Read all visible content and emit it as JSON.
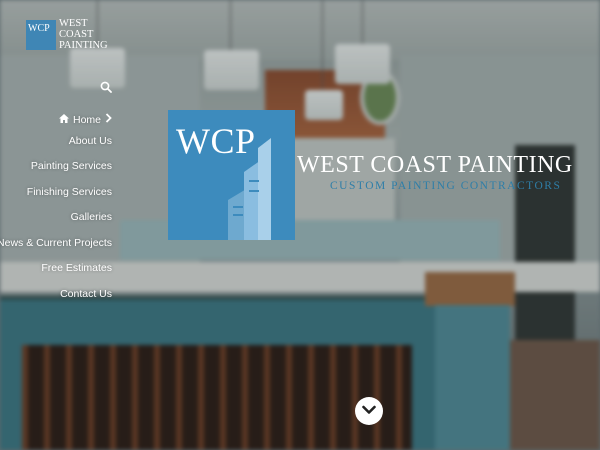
{
  "brand": {
    "mark_text": "WCP",
    "name_lines": [
      "WEST",
      "COAST",
      "PAINTING"
    ]
  },
  "nav": {
    "search_icon": "search-icon",
    "items": [
      {
        "label": "Home",
        "icon": "home-icon",
        "has_arrow": true
      },
      {
        "label": "About Us"
      },
      {
        "label": "Painting Services"
      },
      {
        "label": "Finishing Services"
      },
      {
        "label": "Galleries"
      },
      {
        "label": "News & Current Projects"
      },
      {
        "label": "Free Estimates"
      },
      {
        "label": "Contact Us"
      }
    ]
  },
  "hero": {
    "logo_letters": "WCP",
    "title": "WEST COAST PAINTING",
    "subtitle": "CUSTOM PAINTING CONTRACTORS"
  },
  "scroll_icon": "chevron-down-icon",
  "colors": {
    "brand_blue": "#3d8bbd",
    "subtitle_blue": "#2e7ea8"
  }
}
